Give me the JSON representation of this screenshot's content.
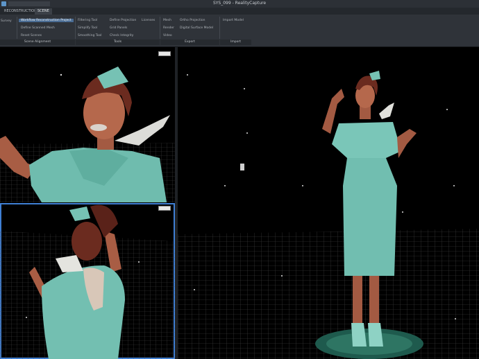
{
  "window": {
    "title": "SYS_099 - RealityCapture"
  },
  "tabs": [
    {
      "label": "RECONSTRUCTION",
      "active": false
    },
    {
      "label": "SCENE",
      "active": true
    }
  ],
  "ribbon": {
    "col0": [
      "Survey"
    ],
    "col1": [
      "Workflow Reconstruction Project",
      "Define Scanned Mesh",
      "Reset Scenes"
    ],
    "col2": [
      "Filtering Tool",
      "Simplify Tool",
      "Smoothing Tool"
    ],
    "col3": [
      "Define Projection",
      "Grid Panels",
      "Check Integrity"
    ],
    "col4": [
      "Licenses"
    ],
    "col5": [
      "Mesh",
      "Render",
      "Video"
    ],
    "col6": [
      "Ortho Projection",
      "Digital Surface Model"
    ],
    "col7": [
      "Import Model"
    ],
    "groups": [
      "Scene Alignment",
      "Tools",
      "Export",
      "Import"
    ]
  },
  "viewports": {
    "top_left": {
      "name": "3D view top-left"
    },
    "bottom_left": {
      "name": "3D view bottom-left"
    },
    "right": {
      "name": "3D view main"
    }
  },
  "colors": {
    "accent": "#3f7fd4",
    "dress": "#76c2b4",
    "skin": "#b5684c",
    "hair": "#6b2b1f",
    "grid": "#4d4d4d"
  }
}
